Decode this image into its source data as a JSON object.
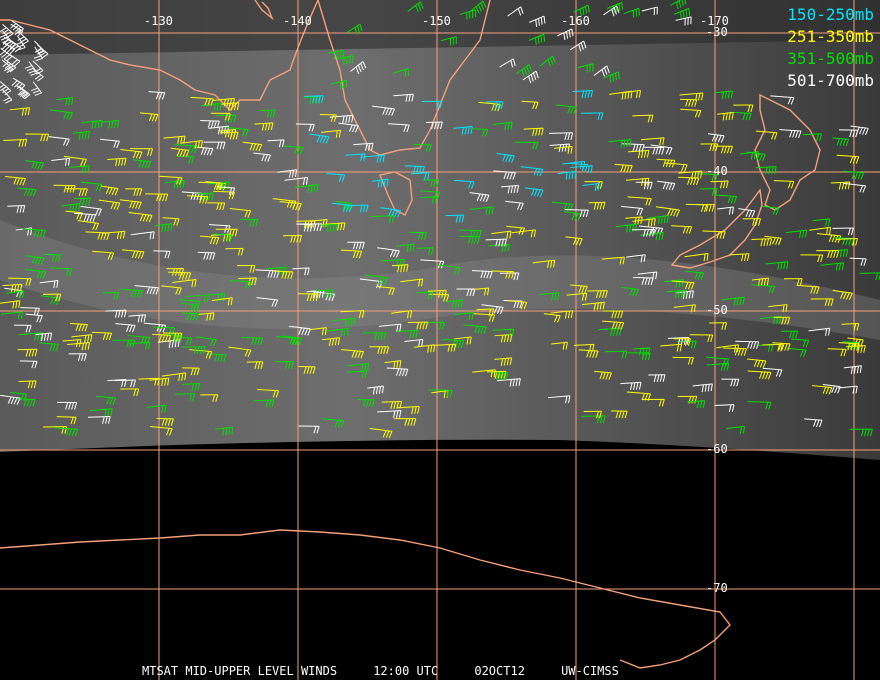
{
  "legend": [
    {
      "label": "150-250mb",
      "color": "#00e6ff"
    },
    {
      "label": "251-350mb",
      "color": "#ffff00"
    },
    {
      "label": "351-500mb",
      "color": "#00e000"
    },
    {
      "label": "501-700mb",
      "color": "#ffffff"
    }
  ],
  "lon_labels": [
    "-130",
    "-140",
    "-150",
    "-160",
    "-170"
  ],
  "lat_labels": [
    "-30",
    "-40",
    "-50",
    "-60",
    "-70"
  ],
  "footer": {
    "product": "MTSAT MID-UPPER LEVEL WINDS",
    "time": "12:00 UTC",
    "date": "02OCT12",
    "source": "UW-CIMSS"
  },
  "colors": {
    "coastline": "#f5a07a",
    "grid": "#f5a07a",
    "ice": "#000000"
  }
}
